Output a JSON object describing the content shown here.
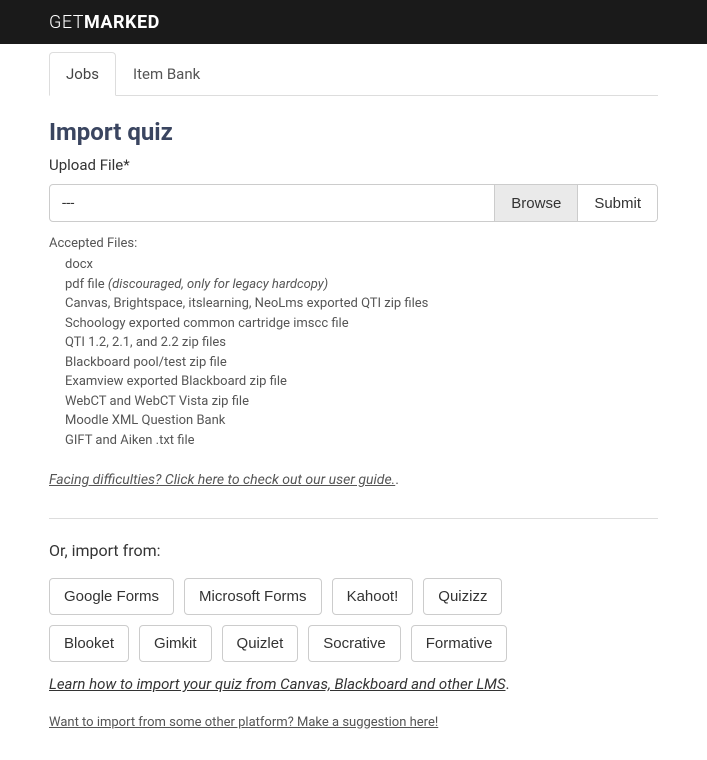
{
  "logo": {
    "part1": "GET",
    "part2": "MARKED"
  },
  "tabs": [
    {
      "label": "Jobs",
      "active": true
    },
    {
      "label": "Item Bank",
      "active": false
    }
  ],
  "page_title": "Import quiz",
  "upload_label": "Upload File*",
  "file_field_value": "---",
  "browse_label": "Browse",
  "submit_label": "Submit",
  "accepted_label": "Accepted Files:",
  "accepted_files": [
    {
      "text": "docx",
      "note": ""
    },
    {
      "text": "pdf file ",
      "note": "(discouraged, only for legacy hardcopy)"
    },
    {
      "text": "Canvas, Brightspace, itslearning, NeoLms exported QTI zip files",
      "note": ""
    },
    {
      "text": "Schoology exported common cartridge imscc file",
      "note": ""
    },
    {
      "text": "QTI 1.2, 2.1, and 2.2 zip files",
      "note": ""
    },
    {
      "text": "Blackboard pool/test zip file",
      "note": ""
    },
    {
      "text": "Examview exported Blackboard zip file",
      "note": ""
    },
    {
      "text": "WebCT and WebCT Vista zip file",
      "note": ""
    },
    {
      "text": "Moodle XML Question Bank",
      "note": ""
    },
    {
      "text": "GIFT and Aiken .txt file",
      "note": ""
    }
  ],
  "help_link": "Facing difficulties? Click here to check out our user guide.",
  "or_label": "Or, import from:",
  "platforms_row1": [
    "Google Forms",
    "Microsoft Forms",
    "Kahoot!",
    "Quizizz"
  ],
  "platforms_row2": [
    "Blooket",
    "Gimkit",
    "Quizlet",
    "Socrative",
    "Formative"
  ],
  "lms_link": "Learn how to import your quiz from Canvas, Blackboard and other LMS",
  "suggest_link": "Want to import from some other platform? Make a suggestion here!"
}
